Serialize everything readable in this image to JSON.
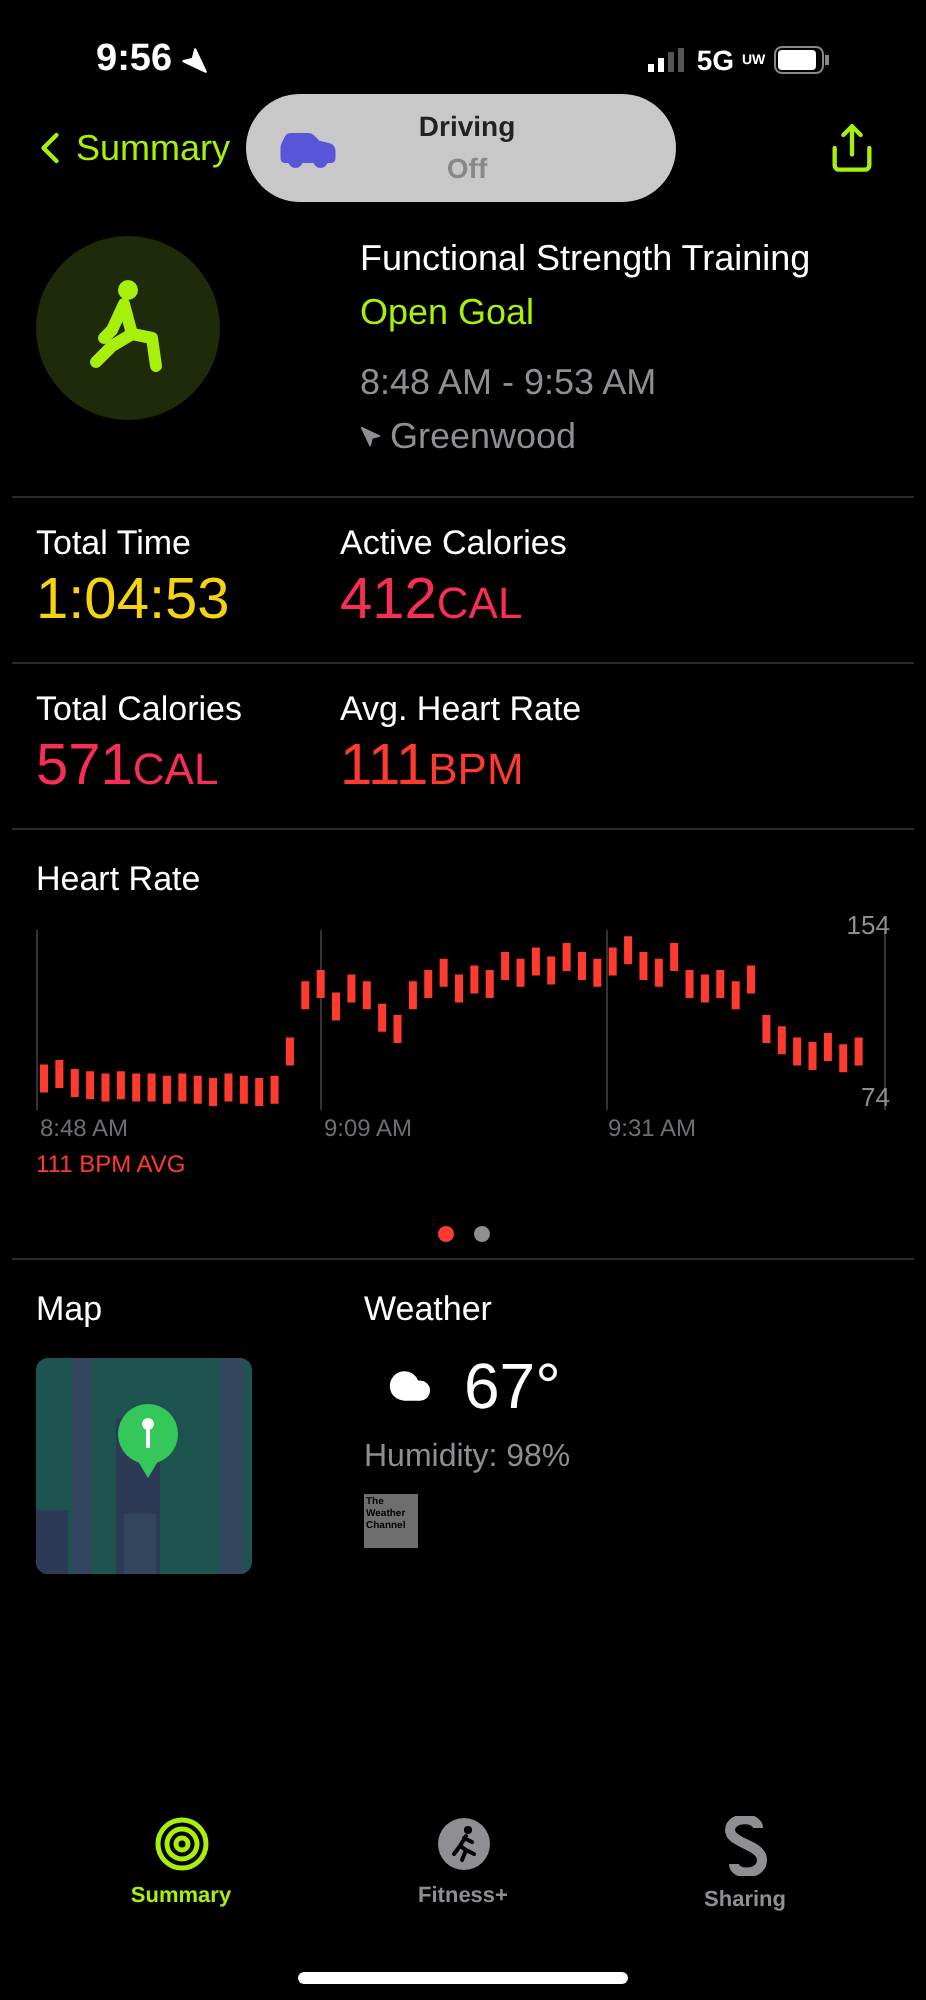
{
  "status_bar": {
    "time": "9:56",
    "network": "5G",
    "network_badge": "UW"
  },
  "nav": {
    "back_label": "Summary",
    "focus_pill": {
      "title": "Driving",
      "state": "Off"
    }
  },
  "workout": {
    "title": "Functional Strength Training",
    "goal": "Open Goal",
    "time_range": "8:48 AM - 9:53 AM",
    "location": "Greenwood"
  },
  "stats": [
    {
      "label": "Total Time",
      "value": "1:04:53",
      "color": "#f5d40f"
    },
    {
      "label": "Active Calories",
      "value": "412",
      "unit": "CAL",
      "color": "#fa2d55"
    },
    {
      "label": "Total Calories",
      "value": "571",
      "unit": "CAL",
      "color": "#fa2d55"
    },
    {
      "label": "Avg. Heart Rate",
      "value": "111",
      "unit": "BPM",
      "color": "#ff3b30"
    }
  ],
  "heart_rate": {
    "title": "Heart Rate",
    "max_label": "154",
    "min_label": "74",
    "time_labels": [
      "8:48 AM",
      "9:09 AM",
      "9:31 AM"
    ],
    "average": "111 BPM AVG"
  },
  "pager": [
    {
      "selected": true
    },
    {
      "selected": false
    }
  ],
  "map": {
    "title": "Map"
  },
  "weather": {
    "title": "Weather",
    "temperature": "67°",
    "humidity": "Humidity: 98%",
    "logo_text": "The Weather Channel"
  },
  "tabs": [
    {
      "label": "Summary",
      "selected": true
    },
    {
      "label": "Fitness+",
      "selected": false
    },
    {
      "label": "Sharing",
      "selected": false
    }
  ]
}
